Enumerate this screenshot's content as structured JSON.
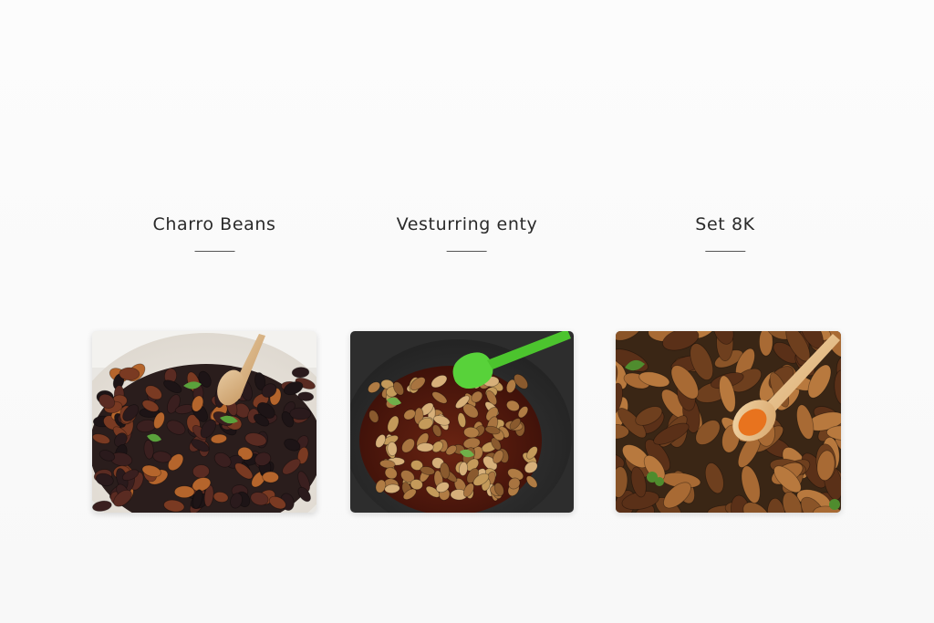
{
  "recipes": [
    {
      "title": "Charro Beans",
      "image_icon": "black-beans-bowl-photo-icon"
    },
    {
      "title": "Vesturring enty",
      "image_icon": "bean-stew-pot-photo-icon"
    },
    {
      "title": "Set 8K",
      "image_icon": "roasted-beans-photo-icon"
    }
  ]
}
